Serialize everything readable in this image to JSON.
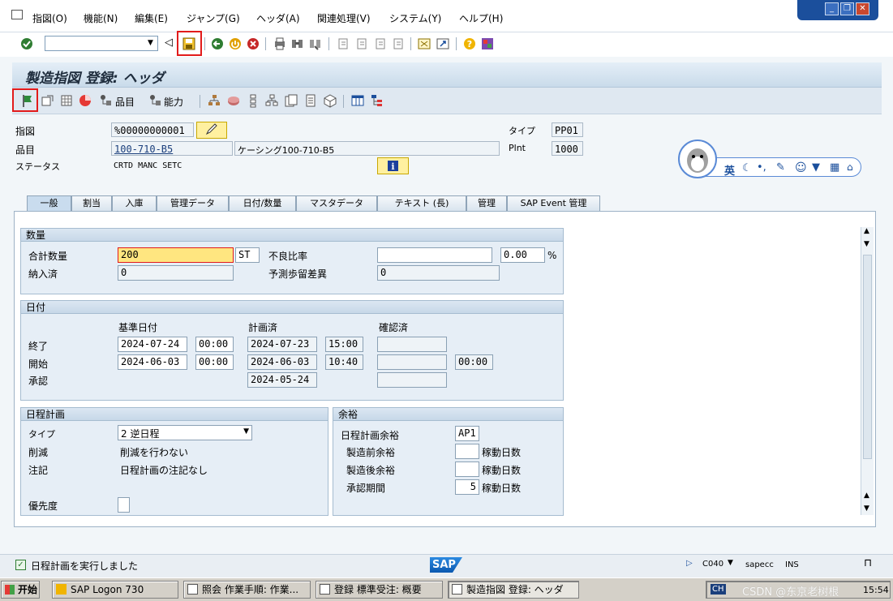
{
  "menubar": {
    "items": [
      "指図(O)",
      "機能(N)",
      "編集(E)",
      "ジャンプ(G)",
      "ヘッダ(A)",
      "関連処理(V)",
      "システム(Y)",
      "ヘルプ(H)"
    ]
  },
  "screen": {
    "title": "製造指図 登録: ヘッダ",
    "app_toolbar": {
      "component_label": "品目",
      "capacity_label": "能力"
    }
  },
  "header": {
    "order_label": "指図",
    "order_value": "%00000000001",
    "material_label": "品目",
    "material_value": "100-710-B5",
    "material_desc": "ケーシング100-710-B5",
    "status_label": "ステータス",
    "status_value": "CRTD MANC SETC",
    "type_label": "タイプ",
    "type_value": "PP01",
    "plant_label": "Plnt",
    "plant_value": "1000"
  },
  "tabs": [
    "一般",
    "割当",
    "入庫",
    "管理データ",
    "日付/数量",
    "マスタデータ",
    "テキスト (長)",
    "管理",
    "SAP Event 管理"
  ],
  "quantity": {
    "title": "数量",
    "total_label": "合計数量",
    "total_value": "200",
    "unit": "ST",
    "scrap_label": "不良比率",
    "scrap_value": "",
    "scrap_pct": "0.00",
    "pct_sign": "%",
    "delivered_label": "納入済",
    "delivered_value": "0",
    "expected_var_label": "予測歩留差異",
    "expected_var_value": "0"
  },
  "dates": {
    "title": "日付",
    "col_basic": "基準日付",
    "col_scheduled": "計画済",
    "col_confirmed": "確認済",
    "end_label": "終了",
    "start_label": "開始",
    "release_label": "承認",
    "end_basic_date": "2024-07-24",
    "end_basic_time": "00:00",
    "end_sched_date": "2024-07-23",
    "end_sched_time": "15:00",
    "start_basic_date": "2024-06-03",
    "start_basic_time": "00:00",
    "start_sched_date": "2024-06-03",
    "start_sched_time": "10:40",
    "start_conf_time": "00:00",
    "release_sched_date": "2024-05-24"
  },
  "scheduling": {
    "title": "日程計画",
    "type_label": "タイプ",
    "type_value": "2 逆日程",
    "reduction_label": "削減",
    "reduction_value": "削減を行わない",
    "note_label": "注記",
    "note_value": "日程計画の注記なし",
    "priority_label": "優先度",
    "priority_value": ""
  },
  "floats": {
    "title": "余裕",
    "sched_margin_label": "日程計画余裕",
    "sched_margin_value": "AP1",
    "float_before_label": "製造前余裕",
    "float_before_value": "",
    "float_after_label": "製造後余裕",
    "float_after_value": "",
    "release_period_label": "承認期間",
    "release_period_value": "5",
    "workdays_label": "稼動日数"
  },
  "statusbar": {
    "message": "日程計画を実行しました",
    "system": "C040",
    "client": "sapecc",
    "mode": "INS"
  },
  "qq_toolbar": {
    "lang": "英"
  },
  "taskbar": {
    "start": "开始",
    "tasks": [
      "SAP Logon 730",
      "照会 作業手順: 作業...",
      "登録 標準受注: 概要",
      "製造指図 登録: ヘッダ"
    ],
    "ime": "CH",
    "clock": "15:54",
    "watermark": "CSDN @东京老树根"
  },
  "colors": {
    "accent": "#1b4f9c",
    "highlight_box": "#e21b1b",
    "input_focus": "#ffe680"
  }
}
